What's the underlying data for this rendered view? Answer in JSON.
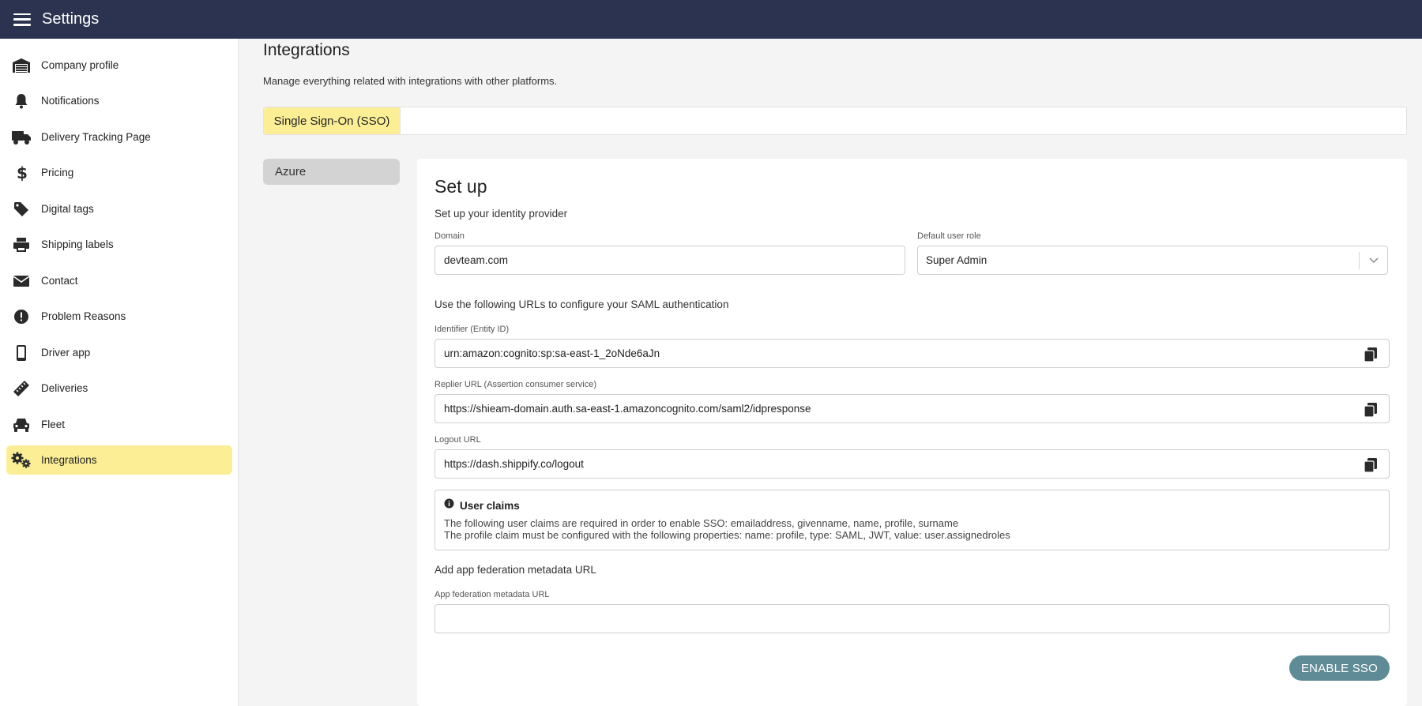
{
  "topbar": {
    "title": "Settings",
    "menu_icon": "hamburger-icon"
  },
  "sidebar": {
    "items": [
      {
        "label": "Company profile",
        "icon": "garage-icon",
        "active": false
      },
      {
        "label": "Notifications",
        "icon": "bell-icon",
        "active": false
      },
      {
        "label": "Delivery Tracking Page",
        "icon": "truck-icon",
        "active": false
      },
      {
        "label": "Pricing",
        "icon": "dollar-icon",
        "active": false
      },
      {
        "label": "Digital tags",
        "icon": "tag-icon",
        "active": false
      },
      {
        "label": "Shipping labels",
        "icon": "printer-icon",
        "active": false
      },
      {
        "label": "Contact",
        "icon": "envelope-icon",
        "active": false
      },
      {
        "label": "Problem Reasons",
        "icon": "exclamation-circle-icon",
        "active": false
      },
      {
        "label": "Driver app",
        "icon": "mobile-icon",
        "active": false
      },
      {
        "label": "Deliveries",
        "icon": "ruler-icon",
        "active": false
      },
      {
        "label": "Fleet",
        "icon": "car-icon",
        "active": false
      },
      {
        "label": "Integrations",
        "icon": "gears-icon",
        "active": true
      }
    ]
  },
  "main": {
    "title": "Integrations",
    "description": "Manage everything related with integrations with other platforms.",
    "tabs": [
      {
        "label": "Single Sign-On (SSO)",
        "active": true
      }
    ],
    "providers": [
      {
        "label": "Azure",
        "active": true
      }
    ]
  },
  "setup": {
    "title": "Set up",
    "subtitle": "Set up your identity provider",
    "domain": {
      "label": "Domain",
      "value": "devteam.com"
    },
    "role": {
      "label": "Default user role",
      "value": "Super Admin"
    },
    "urls_heading": "Use the following URLs to configure your SAML authentication",
    "identifier": {
      "label": "Identifier (Entity ID)",
      "value": "urn:amazon:cognito:sp:sa-east-1_2oNde6aJn"
    },
    "replier": {
      "label": "Replier URL (Assertion consumer service)",
      "value": "https://shieam-domain.auth.sa-east-1.amazoncognito.com/saml2/idpresponse"
    },
    "logout": {
      "label": "Logout URL",
      "value": "https://dash.shippify.co/logout"
    },
    "claims": {
      "title": "User claims",
      "line1": "The following user claims are required in order to enable SSO: emailaddress, givenname, name, profile, surname",
      "line2": "The profile claim must be configured with the following properties: name: profile, type: SAML, JWT, value: user.assignedroles"
    },
    "metadata_heading": "Add app federation metadata URL",
    "metadata": {
      "label": "App federation metadata URL",
      "value": ""
    },
    "enable_button": "ENABLE SSO"
  },
  "colors": {
    "topbar": "#2b3350",
    "highlight": "#fbee95",
    "button": "#5f8b96"
  }
}
